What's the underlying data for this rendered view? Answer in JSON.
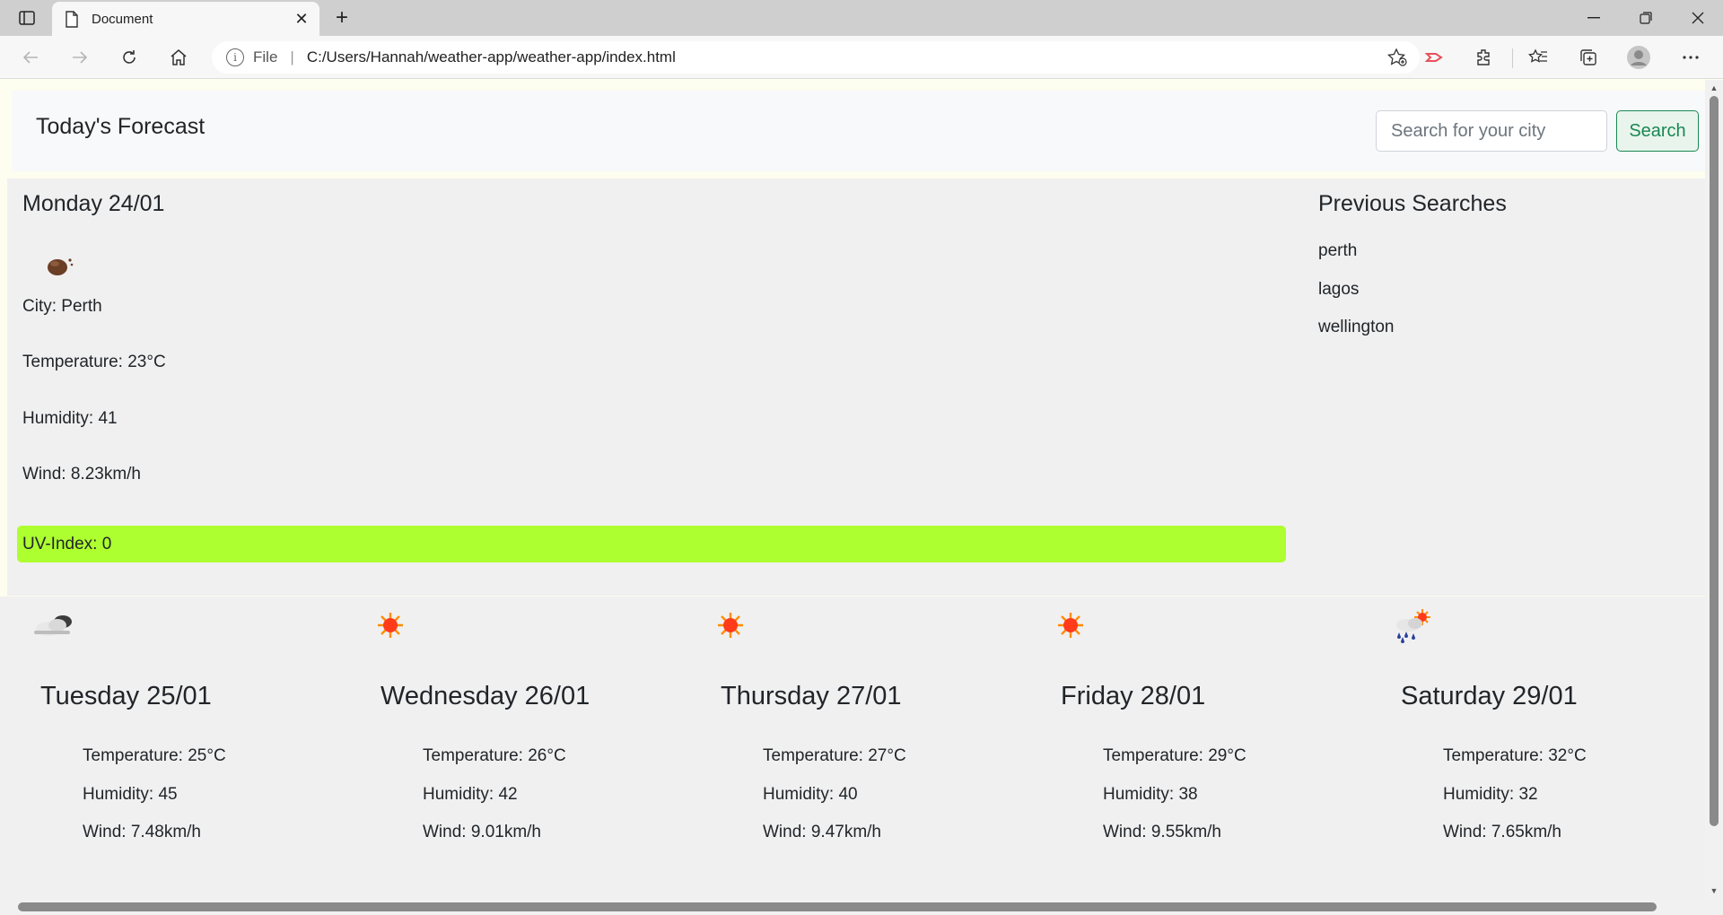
{
  "browser": {
    "tab_title": "Document",
    "address_scheme": "File",
    "address_url": "C:/Users/Hannah/weather-app/weather-app/index.html"
  },
  "header": {
    "title": "Today's Forecast",
    "search_placeholder": "Search for your city",
    "search_button": "Search"
  },
  "today": {
    "date": "Monday 24/01",
    "icon": "cloudy-icon",
    "city": "City: Perth",
    "temperature": "Temperature: 23°C",
    "humidity": "Humidity: 41",
    "wind": "Wind: 8.23km/h",
    "uv": "UV-Index: 0",
    "uv_color": "#adff2f"
  },
  "previous": {
    "title": "Previous Searches",
    "items": [
      "perth",
      "lagos",
      "wellington"
    ]
  },
  "forecast": [
    {
      "day": "Tuesday 25/01",
      "icon": "cloud-icon",
      "temperature": "Temperature: 25°C",
      "humidity": "Humidity: 45",
      "wind": "Wind: 7.48km/h"
    },
    {
      "day": "Wednesday 26/01",
      "icon": "sun-icon",
      "temperature": "Temperature: 26°C",
      "humidity": "Humidity: 42",
      "wind": "Wind: 9.01km/h"
    },
    {
      "day": "Thursday 27/01",
      "icon": "sun-icon",
      "temperature": "Temperature: 27°C",
      "humidity": "Humidity: 40",
      "wind": "Wind: 9.47km/h"
    },
    {
      "day": "Friday 28/01",
      "icon": "sun-icon",
      "temperature": "Temperature: 29°C",
      "humidity": "Humidity: 38",
      "wind": "Wind: 9.55km/h"
    },
    {
      "day": "Saturday 29/01",
      "icon": "rain-sun-icon",
      "temperature": "Temperature: 32°C",
      "humidity": "Humidity: 32",
      "wind": "Wind: 7.65km/h"
    }
  ]
}
